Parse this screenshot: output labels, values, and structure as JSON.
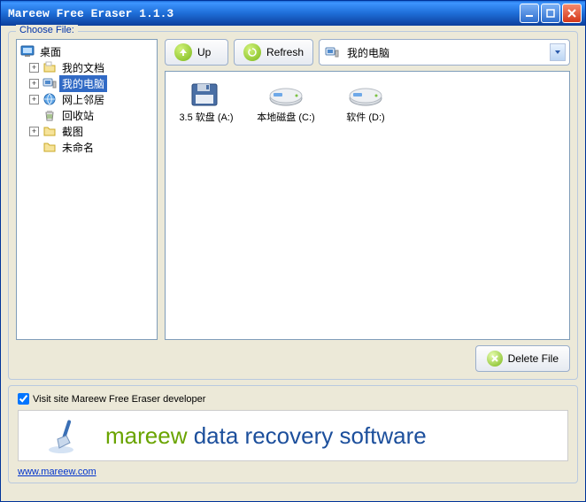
{
  "window": {
    "title": "Mareew Free Eraser 1.1.3"
  },
  "chooser": {
    "label": "Choose File:"
  },
  "tree": {
    "root": "桌面",
    "nodes": [
      {
        "label": "我的文档",
        "expandable": true
      },
      {
        "label": "我的电脑",
        "expandable": true,
        "selected": true
      },
      {
        "label": "网上邻居",
        "expandable": true
      },
      {
        "label": "回收站",
        "expandable": false
      },
      {
        "label": "截图",
        "expandable": true
      },
      {
        "label": "未命名",
        "expandable": false
      }
    ]
  },
  "toolbar": {
    "up_label": "Up",
    "refresh_label": "Refresh",
    "path": "我的电脑"
  },
  "drives": [
    {
      "label": "3.5 软盘 (A:)",
      "kind": "floppy"
    },
    {
      "label": "本地磁盘 (C:)",
      "kind": "hdd"
    },
    {
      "label": "软件 (D:)",
      "kind": "hdd"
    }
  ],
  "buttons": {
    "delete_file": "Delete File"
  },
  "footer": {
    "visit_label": "Visit site Mareew Free Eraser developer",
    "visit_checked": true,
    "brand": "mareew",
    "tagline": "data recovery software",
    "url": "www.mareew.com"
  }
}
